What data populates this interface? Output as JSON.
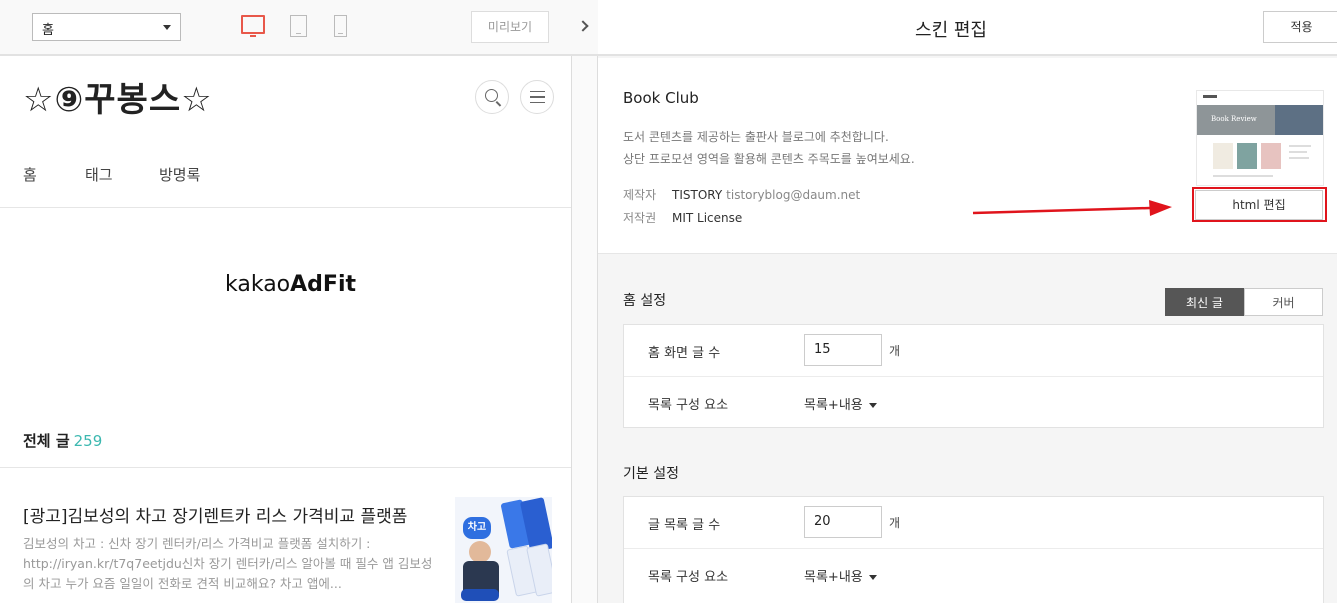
{
  "preview_toolbar": {
    "page_select_value": "홈",
    "preview_button": "미리보기",
    "accent_color": "#e8584a"
  },
  "blog": {
    "title": "☆⑨꾸봉스☆",
    "nav": [
      "홈",
      "태그",
      "방명록"
    ],
    "ad_label_prefix": "kakao",
    "ad_label_bold": "AdFit",
    "total_label": "전체 글",
    "total_count": "259",
    "total_count_color": "#3cb8b0",
    "post": {
      "title": "[광고]김보성의 차고 장기렌트카 리스 가격비교 플랫폼",
      "excerpt": "김보성의 차고 : 신차 장기 렌터카/리스 가격비교 플랫폼 설치하기 : http://iryan.kr/t7q7eetjdu신차 장기 렌터카/리스 알아볼 때 필수 앱 김보성의 차고 누가 요즘 일일이 전화로 견적 비교해요? 차고 앱에...",
      "thumb_badge": "차고"
    }
  },
  "skin_panel": {
    "title": "스킨 편집",
    "apply_button": "적용",
    "skin": {
      "name": "Book Club",
      "description": [
        "도서 콘텐츠를 제공하는 출판사 블로그에 추천합니다.",
        "상단 프로모션 영역을 활용해 콘텐츠 주목도를 높여보세요."
      ],
      "author_label": "제작자",
      "author_value": "TISTORY",
      "author_email": "tistoryblog@daum.net",
      "license_label": "저작권",
      "license_value": "MIT License",
      "thumb_hero_text": "Book Review",
      "html_edit_button": "html 편집",
      "highlight_color": "#e0141c"
    },
    "home_settings": {
      "title": "홈 설정",
      "tabs": [
        "최신 글",
        "커버"
      ],
      "active_tab": "최신 글",
      "post_count_label": "홈 화면 글 수",
      "post_count_value": "15",
      "post_count_unit": "개",
      "list_label": "목록 구성 요소",
      "list_value": "목록+내용"
    },
    "basic_settings": {
      "title": "기본 설정",
      "post_count_label": "글 목록 글 수",
      "post_count_value": "20",
      "post_count_unit": "개",
      "list_label": "목록 구성 요소",
      "list_value": "목록+내용"
    }
  }
}
